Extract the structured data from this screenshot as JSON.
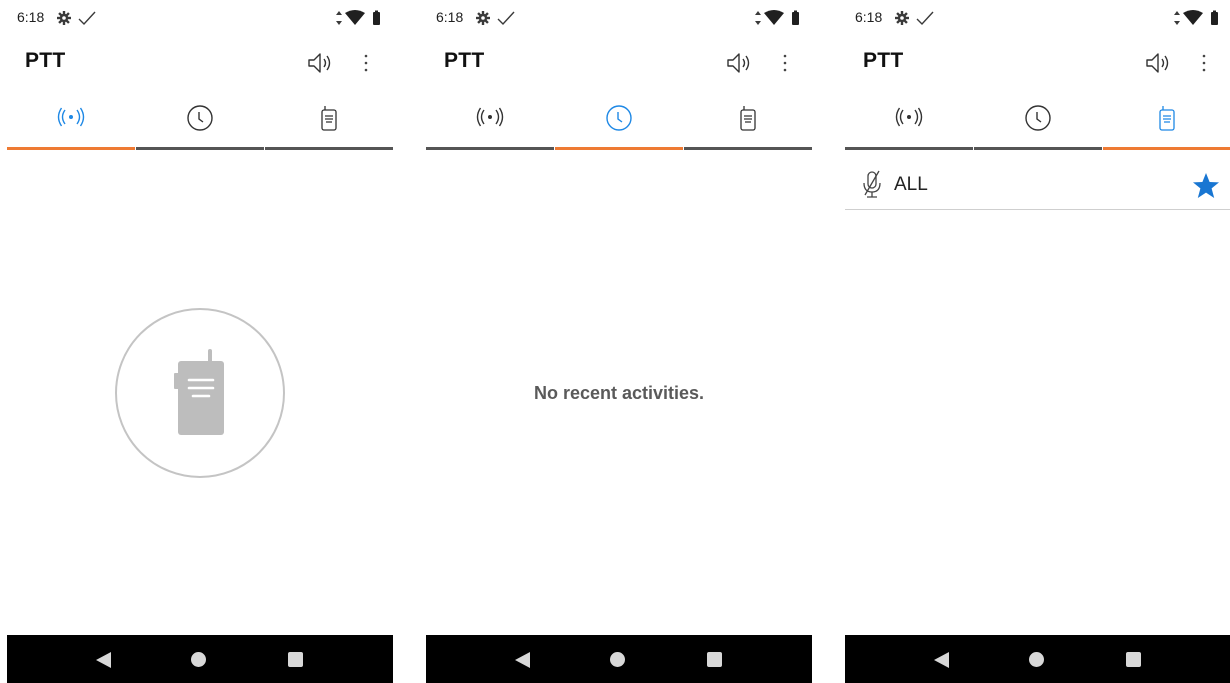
{
  "colors": {
    "accent": "#ee7a33",
    "active_icon": "#1e88e5",
    "inactive_icon": "#3a3a3a",
    "star": "#1976d2",
    "nav_bar": "#000000"
  },
  "status_bar": {
    "time": "6:18",
    "icons": [
      "gear-icon",
      "check-icon",
      "data-arrows-icon",
      "wifi-icon",
      "battery-icon"
    ]
  },
  "app_bar": {
    "title": "PTT",
    "actions": [
      "speaker-icon",
      "more-vert-icon"
    ]
  },
  "tabs": [
    {
      "icon": "broadcast-icon"
    },
    {
      "icon": "clock-icon"
    },
    {
      "icon": "walkie-talkie-icon"
    }
  ],
  "screens": [
    {
      "active_tab": 0,
      "empty_state_icon": "walkie-talkie-icon"
    },
    {
      "active_tab": 1,
      "empty_message": "No recent activities."
    },
    {
      "active_tab": 2,
      "list": [
        {
          "label": "ALL",
          "icon": "mic-off-icon",
          "favorite": true
        }
      ]
    }
  ],
  "nav_bar": {
    "buttons": [
      "back-icon",
      "home-icon",
      "recents-icon"
    ]
  }
}
